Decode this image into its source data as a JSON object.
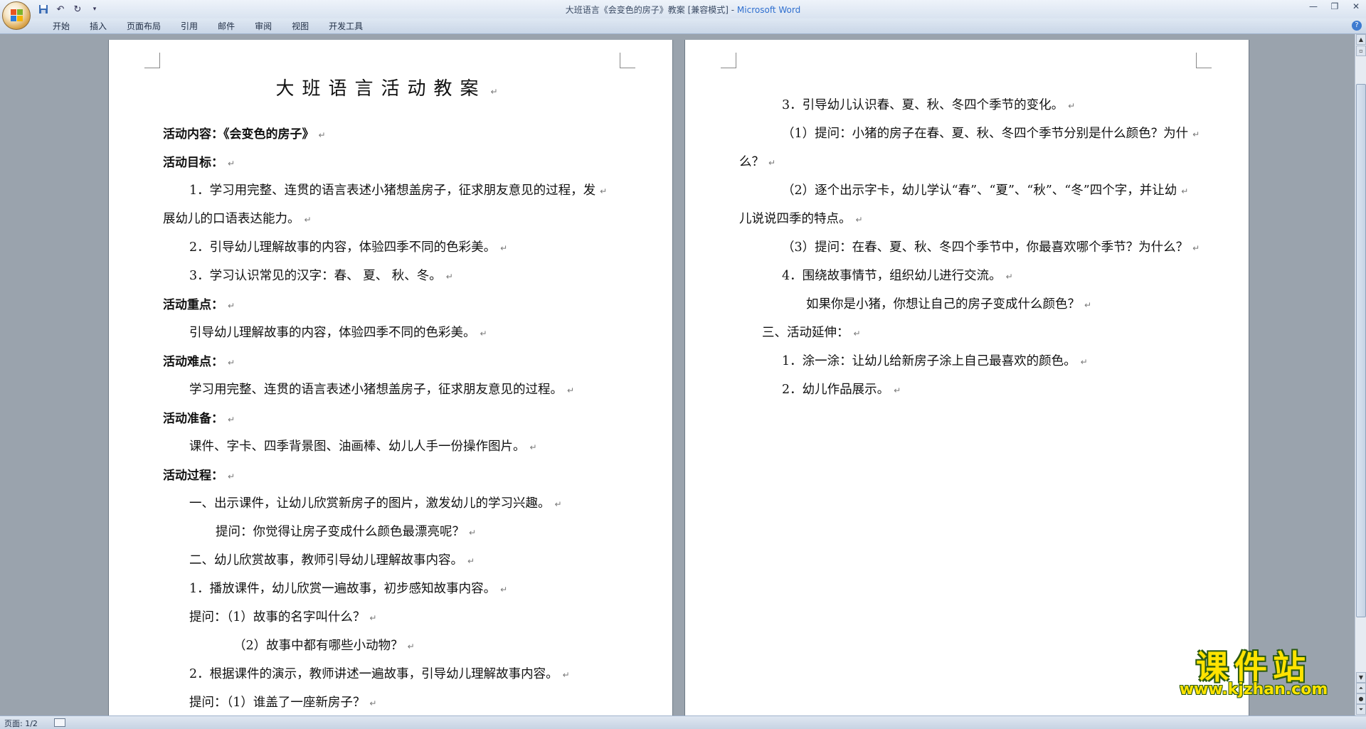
{
  "window": {
    "title": "大班语言《会变色的房子》教案 [兼容模式] - ",
    "app_name": "Microsoft Word",
    "controls": [
      "—",
      "❐",
      "✕"
    ]
  },
  "quick_access": [
    "save-icon",
    "undo-icon",
    "redo-icon",
    "customize-icon"
  ],
  "ribbon": {
    "tabs": [
      "开始",
      "插入",
      "页面布局",
      "引用",
      "邮件",
      "审阅",
      "视图",
      "开发工具"
    ],
    "help": "?"
  },
  "page1": {
    "title": "大班语言活动教案",
    "lines": [
      {
        "text": "活动内容：《会变色的房子》",
        "bold": true
      },
      {
        "text": "活动目标：",
        "bold": true
      },
      {
        "text": "1．学习用完整、连贯的语言表述小猪想盖房子，征求朋友意见的过程，发"
      },
      {
        "text": "展幼儿的口语表达能力。"
      },
      {
        "text": "2．引导幼儿理解故事的内容，体验四季不同的色彩美。"
      },
      {
        "text": "3．学习认识常见的汉字：春、 夏、 秋、冬。"
      },
      {
        "text": "活动重点：",
        "bold": true
      },
      {
        "text": "引导幼儿理解故事的内容，体验四季不同的色彩美。"
      },
      {
        "text": "活动难点：",
        "bold": true
      },
      {
        "text": "学习用完整、连贯的语言表述小猪想盖房子，征求朋友意见的过程。"
      },
      {
        "text": "活动准备：",
        "bold": true
      },
      {
        "text": "课件、字卡、四季背景图、油画棒、幼儿人手一份操作图片。"
      },
      {
        "text": "活动过程：",
        "bold": true
      },
      {
        "text": "一、出示课件，让幼儿欣赏新房子的图片，激发幼儿的学习兴趣。"
      },
      {
        "text": "提问：你觉得让房子变成什么颜色最漂亮呢？"
      },
      {
        "text": "二、幼儿欣赏故事，教师引导幼儿理解故事内容。"
      },
      {
        "text": "1．播放课件，幼儿欣赏一遍故事，初步感知故事内容。"
      },
      {
        "text": "提问：（1）故事的名字叫什么？"
      },
      {
        "text": "（2）故事中都有哪些小动物？"
      },
      {
        "text": "2．根据课件的演示，教师讲述一遍故事，引导幼儿理解故事内容。"
      },
      {
        "text": "提问：（1）谁盖了一座新房子？"
      }
    ]
  },
  "page2": {
    "lines": [
      {
        "text": "3．引导幼儿认识春、夏、秋、冬四个季节的变化。"
      },
      {
        "text": "（1）提问：小猪的房子在春、夏、秋、冬四个季节分别是什么颜色？为什"
      },
      {
        "text": "么？"
      },
      {
        "text": "（2）逐个出示字卡，幼儿学认“春”、“夏”、“秋”、“冬”四个字，并让幼"
      },
      {
        "text": "儿说说四季的特点。"
      },
      {
        "text": "（3）提问：在春、夏、秋、冬四个季节中，你最喜欢哪个季节？为什么？"
      },
      {
        "text": "4．围绕故事情节，组织幼儿进行交流。"
      },
      {
        "text": "如果你是小猪，你想让自己的房子变成什么颜色？"
      },
      {
        "text": "三、活动延伸："
      },
      {
        "text": "1．涂一涂：让幼儿给新房子涂上自己最喜欢的颜色。"
      },
      {
        "text": "2．幼儿作品展示。"
      }
    ]
  },
  "paragraph_mark": "↵",
  "status": {
    "page": "页面: 1/2"
  },
  "watermark": {
    "title": "课件站",
    "url": "www.kjzhan.com"
  }
}
